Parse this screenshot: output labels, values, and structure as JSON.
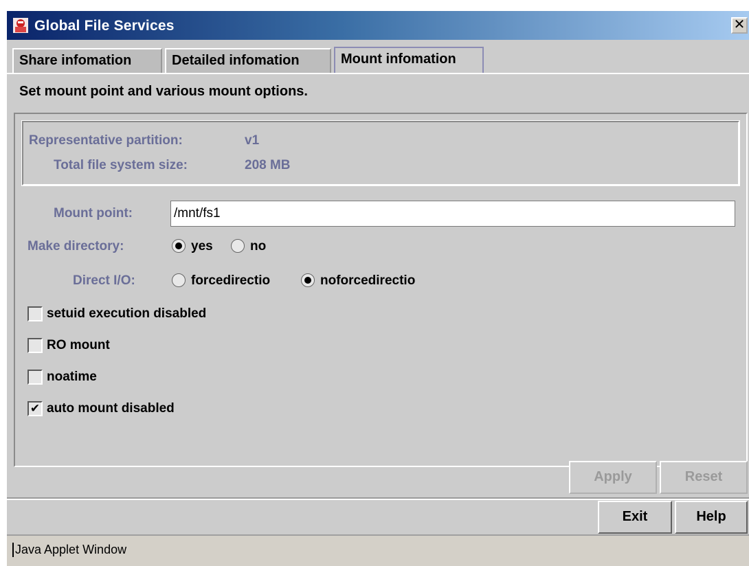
{
  "window": {
    "title": "Global File Services",
    "close_glyph": "✕"
  },
  "tabs": [
    {
      "label": "Share infomation",
      "selected": false
    },
    {
      "label": "Detailed infomation",
      "selected": false
    },
    {
      "label": "Mount infomation",
      "selected": true
    }
  ],
  "instruction": "Set mount point and various mount options.",
  "info": {
    "partition_label": "Representative partition:",
    "partition_value": "v1",
    "size_label": "Total file system size:",
    "size_value": "208 MB"
  },
  "mount_point": {
    "label": "Mount point:",
    "value": "/mnt/fs1"
  },
  "make_directory": {
    "label": "Make directory:",
    "options": [
      {
        "label": "yes",
        "selected": true
      },
      {
        "label": "no",
        "selected": false
      }
    ]
  },
  "direct_io": {
    "label": "Direct I/O:",
    "options": [
      {
        "label": "forcedirectio",
        "selected": false
      },
      {
        "label": "noforcedirectio",
        "selected": true
      }
    ]
  },
  "options": [
    {
      "label": "setuid execution disabled",
      "checked": false
    },
    {
      "label": "RO mount",
      "checked": false
    },
    {
      "label": "noatime",
      "checked": false
    },
    {
      "label": "auto mount disabled",
      "checked": true
    }
  ],
  "buttons": {
    "apply": "Apply",
    "reset": "Reset",
    "exit": "Exit",
    "help": "Help"
  },
  "status_bar": {
    "text": "Java Applet Window"
  },
  "colors": {
    "title_start": "#0a246a",
    "title_end": "#a6caf0",
    "panel": "#cccccc",
    "label": "#6a6e98"
  }
}
